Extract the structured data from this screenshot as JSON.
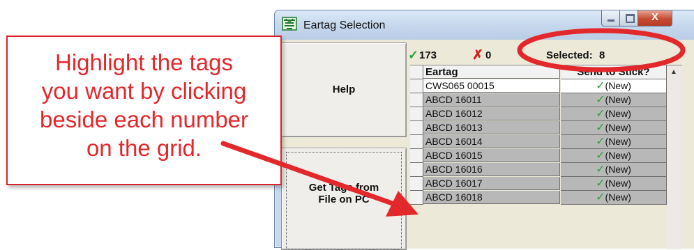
{
  "window": {
    "title": "Eartag Selection",
    "close_glyph": "X"
  },
  "status": {
    "ok_count": "173",
    "err_count": "0",
    "selected_label": "Selected:",
    "selected_count": "8"
  },
  "buttons": {
    "help": "Help",
    "get_tags_line1": "Get Tags from",
    "get_tags_line2": "File on PC"
  },
  "grid": {
    "columns": [
      "Eartag",
      "Send to Stick?"
    ],
    "rows": [
      {
        "eartag": "CWS065 00015",
        "send": "(New)",
        "checked": true
      },
      {
        "eartag": "ABCD 16011",
        "send": "(New)",
        "checked": true
      },
      {
        "eartag": "ABCD 16012",
        "send": "(New)",
        "checked": true
      },
      {
        "eartag": "ABCD 16013",
        "send": "(New)",
        "checked": true
      },
      {
        "eartag": "ABCD 16014",
        "send": "(New)",
        "checked": true
      },
      {
        "eartag": "ABCD 16015",
        "send": "(New)",
        "checked": true
      },
      {
        "eartag": "ABCD 16016",
        "send": "(New)",
        "checked": true
      },
      {
        "eartag": "ABCD 16017",
        "send": "(New)",
        "checked": true
      },
      {
        "eartag": "ABCD 16018",
        "send": "(New)",
        "checked": true
      }
    ]
  },
  "annotation": {
    "lines": [
      "Highlight the tags",
      "you want by clicking",
      "beside each number",
      "on the grid."
    ],
    "color": "#e3282c"
  },
  "icons": {
    "check": "✓",
    "cross": "✗",
    "scroll_up": "▲"
  }
}
